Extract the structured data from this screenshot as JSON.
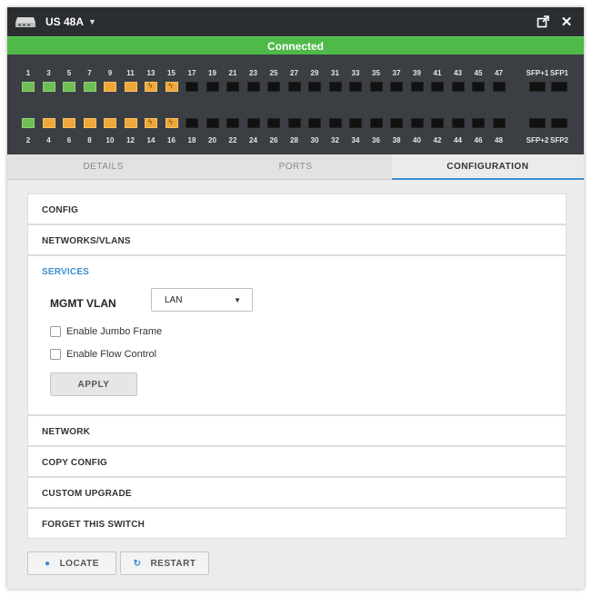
{
  "window": {
    "device_name": "US 48A",
    "device_icon": "switch-icon",
    "popout_icon": "popout-icon",
    "close_icon": "close-icon"
  },
  "status": {
    "text": "Connected",
    "color": "#4fba49"
  },
  "ports": {
    "top_labels": [
      "1",
      "3",
      "5",
      "7",
      "9",
      "11",
      "13",
      "15",
      "17",
      "19",
      "21",
      "23",
      "25",
      "27",
      "29",
      "31",
      "33",
      "35",
      "37",
      "39",
      "41",
      "43",
      "45",
      "47"
    ],
    "bottom_labels": [
      "2",
      "4",
      "6",
      "8",
      "10",
      "12",
      "14",
      "16",
      "18",
      "20",
      "22",
      "24",
      "26",
      "28",
      "30",
      "32",
      "34",
      "36",
      "38",
      "40",
      "42",
      "44",
      "46",
      "48"
    ],
    "top_states": [
      "green",
      "green",
      "green",
      "green",
      "amber",
      "amber",
      "amber-badge",
      "amber-badge",
      "off",
      "off",
      "off",
      "off",
      "off",
      "off",
      "off",
      "off",
      "off",
      "off",
      "off",
      "off",
      "off",
      "off",
      "off",
      "off"
    ],
    "bottom_states": [
      "green",
      "amber",
      "amber",
      "amber",
      "amber",
      "amber",
      "amber-badge",
      "amber-badge",
      "off",
      "off",
      "off",
      "off",
      "off",
      "off",
      "off",
      "off",
      "off",
      "off",
      "off",
      "off",
      "off",
      "off",
      "off",
      "off"
    ],
    "sfp_top_labels": [
      "SFP+1",
      "SFP1"
    ],
    "sfp_bottom_labels": [
      "SFP+2",
      "SFP2"
    ],
    "colors": {
      "green": "#6fbe55",
      "amber": "#f0a73a",
      "off": "#111111"
    }
  },
  "tabs": [
    {
      "label": "DETAILS",
      "active": false
    },
    {
      "label": "PORTS",
      "active": false
    },
    {
      "label": "CONFIGURATION",
      "active": true
    }
  ],
  "sections": {
    "config": "CONFIG",
    "networks_vlans": "NETWORKS/VLANS",
    "services": {
      "title": "SERVICES",
      "mgmt_vlan_label": "MGMT VLAN",
      "mgmt_vlan_value": "LAN",
      "jumbo_frame_label": "Enable Jumbo Frame",
      "flow_control_label": "Enable Flow Control",
      "apply_label": "APPLY"
    },
    "network": "NETWORK",
    "copy_config": "COPY CONFIG",
    "custom_upgrade": "CUSTOM UPGRADE",
    "forget_switch": "FORGET THIS SWITCH"
  },
  "footer": {
    "locate_label": "LOCATE",
    "restart_label": "RESTART"
  },
  "accent_color": "#3a8ed3"
}
